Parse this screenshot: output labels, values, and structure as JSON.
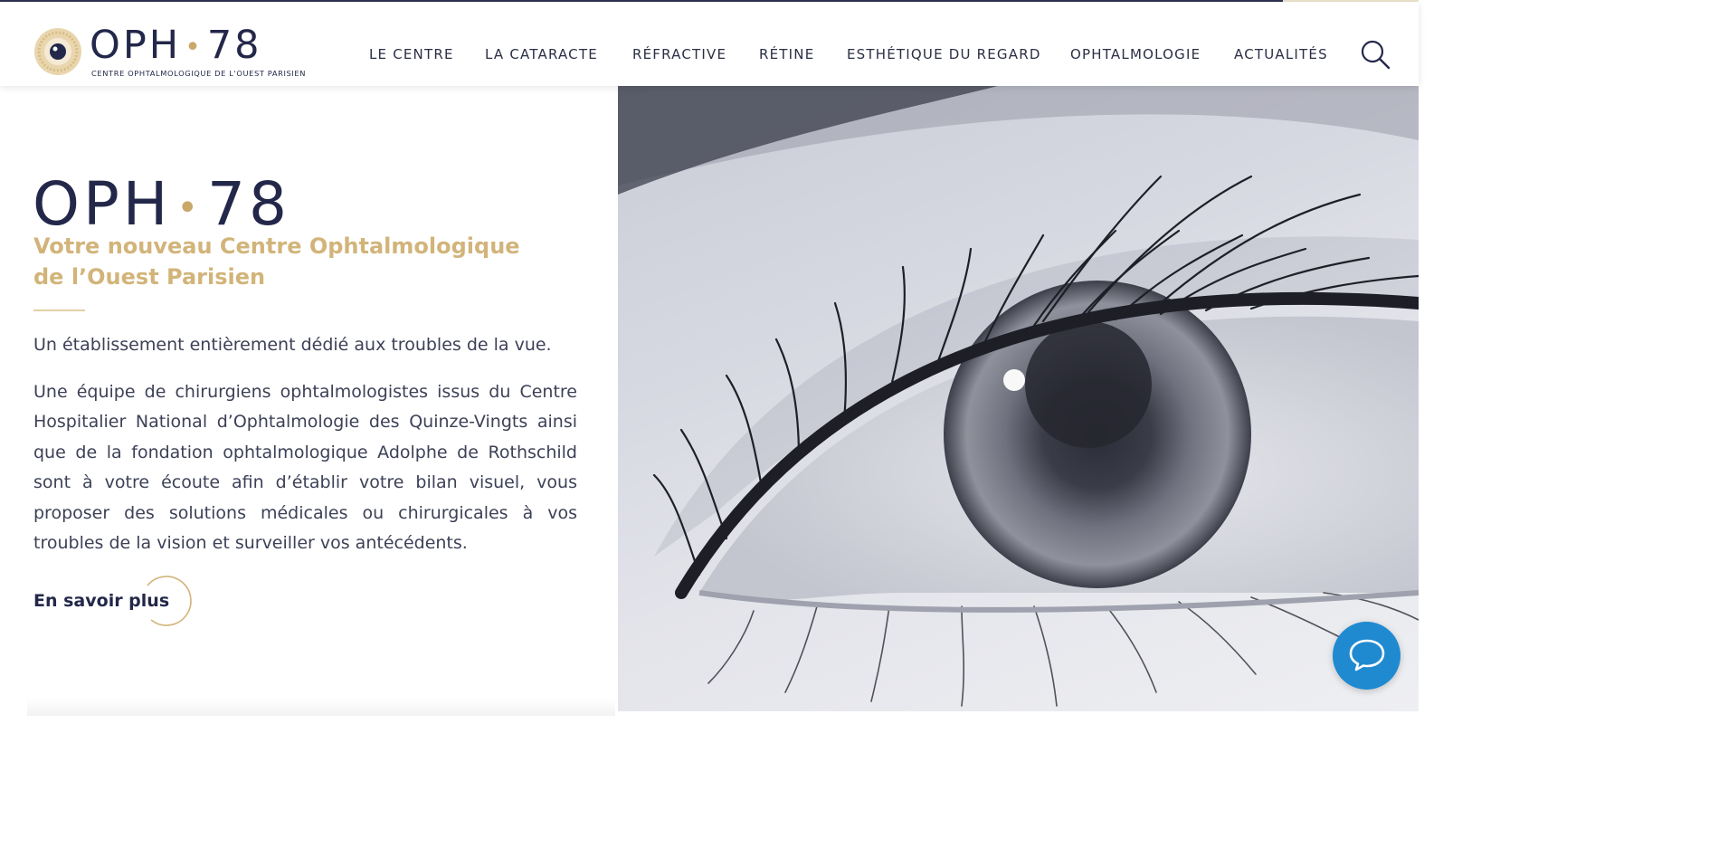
{
  "header": {
    "logo": {
      "word_left": "OPH",
      "word_dot": "•",
      "word_right": "78",
      "tagline": "CENTRE OPHTALMOLOGIQUE DE L'OUEST PARISIEN"
    },
    "nav": [
      {
        "label": "LE CENTRE"
      },
      {
        "label": "LA CATARACTE"
      },
      {
        "label": "RÉFRACTIVE"
      },
      {
        "label": "RÉTINE"
      },
      {
        "label": "ESTHÉTIQUE DU REGARD"
      },
      {
        "label": "OPHTALMOLOGIE"
      },
      {
        "label": "ACTUALITÉS"
      }
    ],
    "search_icon": "search-icon"
  },
  "hero": {
    "brand_left": "OPH",
    "brand_dot": "•",
    "brand_right": "78",
    "subtitle": "Votre nouveau Centre Ophtalmologique de l’Ouest Parisien",
    "intro": "Un établissement entièrement dédié aux troubles de la vue.",
    "body": "Une équipe de chirurgiens ophtalmologistes issus du Centre Hospitalier National d’Ophtalmologie des Quinze-Vingts ainsi que de la fondation ophtalmologique Adolphe de Rothschild sont à votre écoute afin d’établir votre bilan visuel, vous proposer des solutions médicales ou chirurgicales à vos troubles de la vision et surveiller vos antécédents.",
    "cta_label": "En savoir plus"
  },
  "chat": {
    "icon": "chat-bubble-icon"
  },
  "colors": {
    "navy": "#23284a",
    "gold": "#c9a86a",
    "chat_blue": "#1f8ad0"
  }
}
